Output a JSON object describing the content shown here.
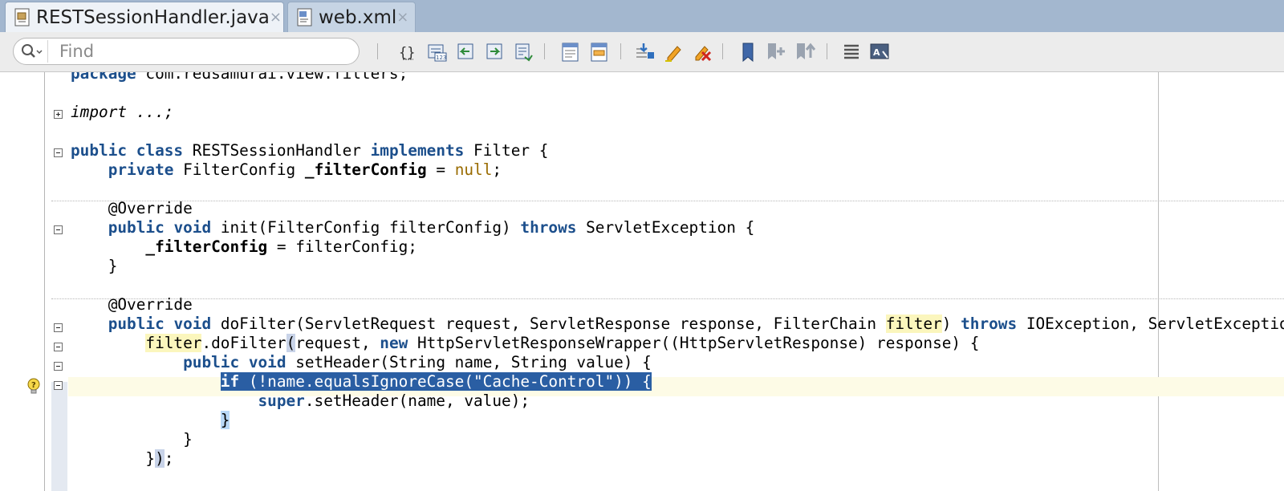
{
  "tabs": [
    {
      "label": "RESTSessionHandler.java",
      "close": "×",
      "icon": "java-file-icon",
      "active": true
    },
    {
      "label": "web.xml",
      "close": "×",
      "icon": "xml-file-icon",
      "active": false
    }
  ],
  "search": {
    "placeholder": "Find",
    "value": ""
  },
  "toolbar_icons": [
    "braces-icon",
    "goto-line-icon",
    "back-icon",
    "forward-icon",
    "last-edit-icon",
    "toggle-comment-icon",
    "uncomment-icon",
    "breakpoint-icon",
    "highlight-icon",
    "clear-highlight-icon",
    "bookmark-icon",
    "prev-bookmark-icon",
    "next-bookmark-icon",
    "list-icon",
    "translate-icon"
  ],
  "code": {
    "l1_pkg_kw": "package",
    "l1_pkg_name": " com.redsamurai.view.filters;",
    "l2_import": "import ...;",
    "l3_public": "public",
    "l3_class": "class",
    "l3_name": " RESTSessionHandler ",
    "l3_implements": "implements",
    "l3_rest": " Filter {",
    "l4_indent": "    ",
    "l4_private": "private",
    "l4_type": " FilterConfig ",
    "l4_field": "_filterConfig",
    "l4_eq": " = ",
    "l4_null": "null",
    "l4_semi": ";",
    "l5_annot": "    @Override",
    "l6_indent": "    ",
    "l6_public": "public",
    "l6_void": "void",
    "l6_sig": " init(FilterConfig filterConfig) ",
    "l6_throws": "throws",
    "l6_rest": " ServletException {",
    "l7_indent": "        ",
    "l7_field": "_filterConfig",
    "l7_rest": " = filterConfig;",
    "l8_close": "    }",
    "l9_annot": "    @Override",
    "l10_indent": "    ",
    "l10_public": "public",
    "l10_void": "void",
    "l10_sig": " doFilter(ServletRequest request, ServletResponse response, FilterChain ",
    "l10_filter": "filter",
    "l10_paren": ") ",
    "l10_throws": "throws",
    "l10_rest": " IOException, ServletException {",
    "l11_indent": "        ",
    "l11_filter": "filter",
    "l11_call": ".doFilter",
    "l11_paren": "(",
    "l11_args": "request, ",
    "l11_new": "new",
    "l11_rest": " HttpServletResponseWrapper((HttpServletResponse) response) {",
    "l12_indent": "            ",
    "l12_public": "public",
    "l12_void": "void",
    "l12_rest": " setHeader(String name, String value) {",
    "l13_indent": "                ",
    "l13_if": "if",
    "l13_rest": " (!name.equalsIgnoreCase(\"Cache-Control\")) {",
    "l14_indent": "                    ",
    "l14_super": "super",
    "l14_rest": ".setHeader(name, value);",
    "l15_indent": "                ",
    "l15_brace": "}",
    "l16_close": "            }",
    "l17_indent": "        ",
    "l17_brace": "}",
    "l17_paren": ")",
    "l17_semi": ";"
  },
  "colors": {
    "keyword": "#1c4f8c",
    "literal": "#996b00",
    "selection": "#2a5ea3",
    "occurrence": "#fbf6bd"
  }
}
